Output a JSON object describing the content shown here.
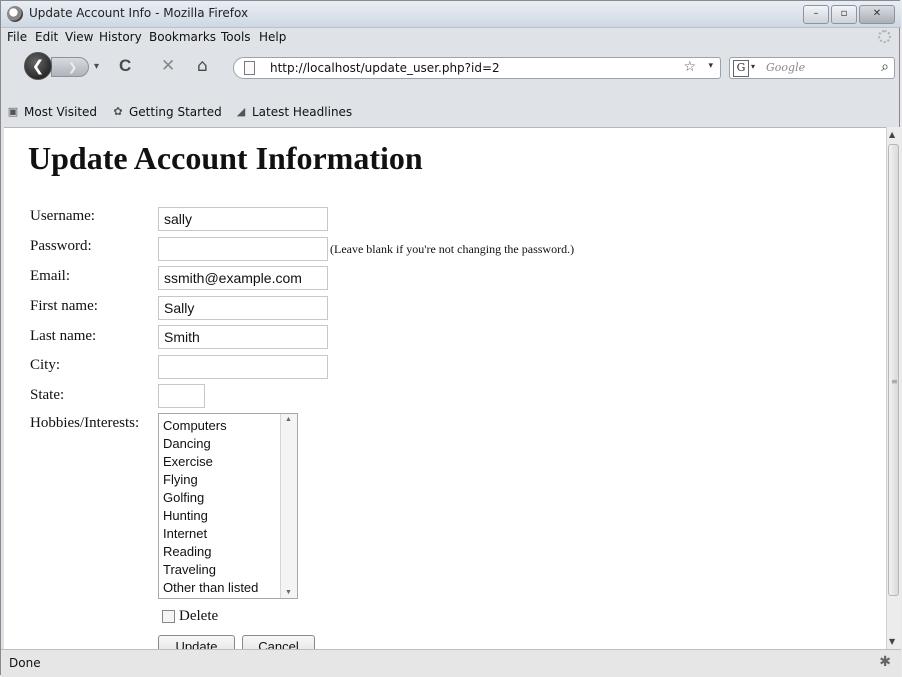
{
  "window": {
    "title": "Update Account Info - Mozilla Firefox",
    "controls": {
      "minimize": "–",
      "maximize": "▫",
      "close": "✕"
    }
  },
  "menubar": {
    "items": [
      "File",
      "Edit",
      "View",
      "History",
      "Bookmarks",
      "Tools",
      "Help"
    ]
  },
  "navbar": {
    "back_glyph": "❮",
    "forward_glyph": "❯",
    "dropdown_glyph": "▾",
    "reload_glyph": "C",
    "stop_glyph": "✕",
    "home_glyph": "⌂",
    "url": "http://localhost/update_user.php?id=2",
    "star_glyph": "☆",
    "url_drop_glyph": "▾",
    "search_engine_glyph": "G",
    "search_drop_glyph": "▾",
    "search_placeholder": "Google",
    "search_glyph": "⌕"
  },
  "bookmarks": {
    "items": [
      {
        "label": "Most Visited",
        "icon": "most-visited-icon",
        "glyph": "▣"
      },
      {
        "label": "Getting Started",
        "icon": "getting-started-icon",
        "glyph": "✿"
      },
      {
        "label": "Latest Headlines",
        "icon": "rss-icon",
        "glyph": "◢"
      }
    ]
  },
  "page": {
    "heading": "Update Account Information",
    "fields": {
      "username": {
        "label": "Username:",
        "value": "sally"
      },
      "password": {
        "label": "Password:",
        "value": "",
        "hint": "(Leave blank if you're not changing the password.)"
      },
      "email": {
        "label": "Email:",
        "value": "ssmith@example.com"
      },
      "first_name": {
        "label": "First name:",
        "value": "Sally"
      },
      "last_name": {
        "label": "Last name:",
        "value": "Smith"
      },
      "city": {
        "label": "City:",
        "value": ""
      },
      "state": {
        "label": "State:",
        "value": ""
      }
    },
    "hobbies": {
      "label": "Hobbies/Interests:",
      "options": [
        "Computers",
        "Dancing",
        "Exercise",
        "Flying",
        "Golfing",
        "Hunting",
        "Internet",
        "Reading",
        "Traveling",
        "Other than listed"
      ],
      "scroll_up_glyph": "▲",
      "scroll_down_glyph": "▼"
    },
    "delete_label": "Delete",
    "update_button": "Update",
    "cancel_button": "Cancel"
  },
  "scrollbar": {
    "up_glyph": "▲",
    "down_glyph": "▼",
    "grip_glyph": "≡"
  },
  "status": {
    "text": "Done",
    "addon_glyph": "✱"
  }
}
